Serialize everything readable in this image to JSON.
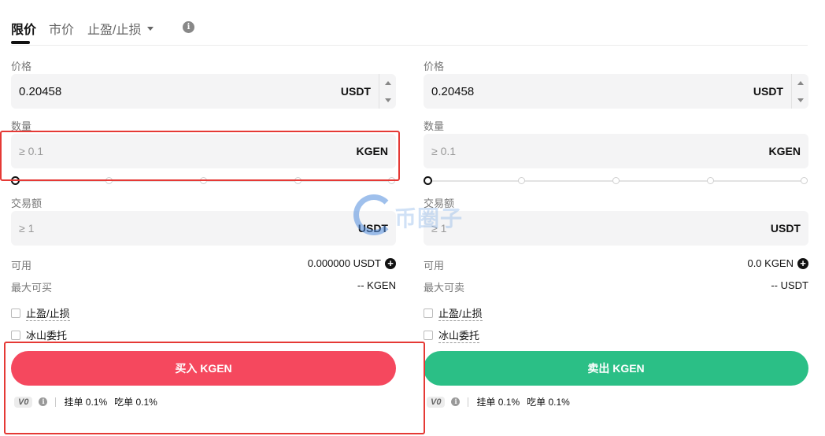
{
  "tabs": {
    "limit": "限价",
    "market": "市价",
    "tp_sl": "止盈/止损"
  },
  "buy": {
    "price_label": "价格",
    "price_value": "0.20458",
    "price_unit": "USDT",
    "amount_label": "数量",
    "amount_placeholder": "≥ 0.1",
    "amount_unit": "KGEN",
    "total_label": "交易额",
    "total_placeholder": "≥ 1",
    "total_unit": "USDT",
    "available_label": "可用",
    "available_value": "0.000000 USDT",
    "max_label": "最大可买",
    "max_value": "-- KGEN",
    "check_tp_sl": "止盈/止损",
    "check_iceberg": "冰山委托",
    "button": "买入 KGEN",
    "vip": "V0",
    "maker_fee": "挂单 0.1%",
    "taker_fee": "吃单 0.1%"
  },
  "sell": {
    "price_label": "价格",
    "price_value": "0.20458",
    "price_unit": "USDT",
    "amount_label": "数量",
    "amount_placeholder": "≥ 0.1",
    "amount_unit": "KGEN",
    "total_label": "交易额",
    "total_placeholder": "≥ 1",
    "total_unit": "USDT",
    "available_label": "可用",
    "available_value": "0.0 KGEN",
    "max_label": "最大可卖",
    "max_value": "-- USDT",
    "check_tp_sl": "止盈/止损",
    "check_iceberg": "冰山委托",
    "button": "卖出 KGEN",
    "vip": "V0",
    "maker_fee": "挂单 0.1%",
    "taker_fee": "吃单 0.1%"
  },
  "watermark": "币圈子",
  "colors": {
    "buy": "#f5485e",
    "sell": "#2bbf86",
    "highlight": "#e53935"
  },
  "icons": {
    "info": "info-circle-icon",
    "caret": "caret-down-icon",
    "plus": "plus-circle-icon"
  }
}
